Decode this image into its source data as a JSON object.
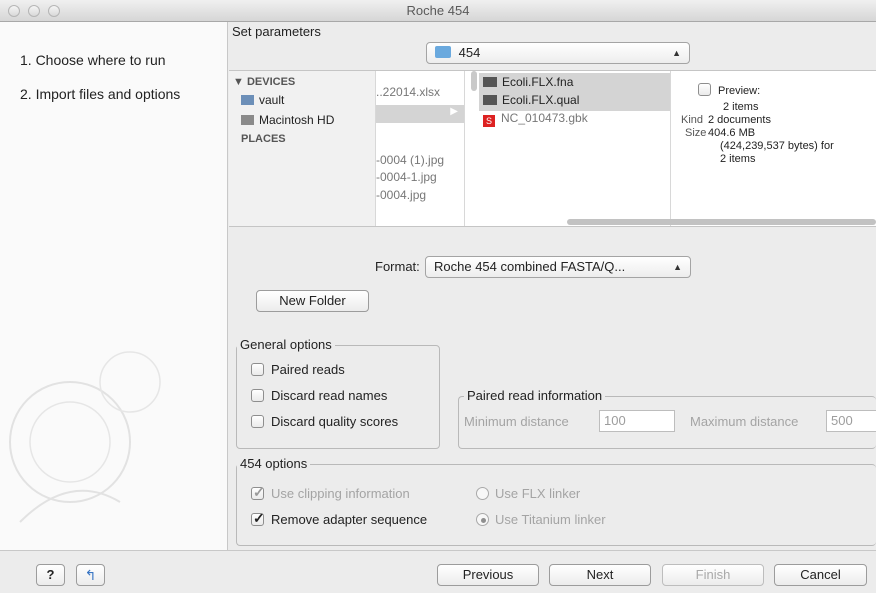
{
  "window": {
    "title": "Roche 454"
  },
  "sidebar": {
    "steps": [
      {
        "label": "1.  Choose where to run"
      },
      {
        "label": "2.  Import files and options"
      }
    ]
  },
  "main": {
    "section_title": "Set parameters",
    "folder_popup": {
      "value": "454"
    },
    "browser": {
      "devices_label": "DEVICES",
      "devices": [
        {
          "label": "vault"
        },
        {
          "label": "Macintosh HD"
        }
      ],
      "places_label": "PLACES",
      "col1": [
        "..22014.xlsx",
        "-0004 (1).jpg",
        "-0004-1.jpg",
        "-0004.jpg"
      ],
      "files": [
        {
          "label": "Ecoli.FLX.fna"
        },
        {
          "label": "Ecoli.FLX.qual"
        },
        {
          "label": "NC_010473.gbk"
        }
      ],
      "preview": {
        "label": "Preview:",
        "count": "2 items",
        "kind_label": "Kind",
        "kind_value": "2 documents",
        "size_label": "Size",
        "size_value": "404.6 MB",
        "size_detail": "(424,239,537 bytes) for",
        "size_detail2": "2 items"
      }
    },
    "format": {
      "label": "Format:",
      "value": "Roche 454 combined FASTA/Q..."
    },
    "new_folder_label": "New Folder",
    "general_options": {
      "title": "General options",
      "paired_reads": "Paired reads",
      "discard_read_names": "Discard read names",
      "discard_quality_scores": "Discard quality scores"
    },
    "paired_info": {
      "title": "Paired read information",
      "min_label": "Minimum distance",
      "min_value": "100",
      "max_label": "Maximum distance",
      "max_value": "500"
    },
    "options_454": {
      "title": "454 options",
      "use_clipping": "Use clipping information",
      "remove_adapter": "Remove adapter sequence",
      "use_flx": "Use FLX linker",
      "use_titanium": "Use Titanium linker"
    }
  },
  "footer": {
    "help_label": "?",
    "previous_label": "Previous",
    "next_label": "Next",
    "finish_label": "Finish",
    "cancel_label": "Cancel"
  }
}
